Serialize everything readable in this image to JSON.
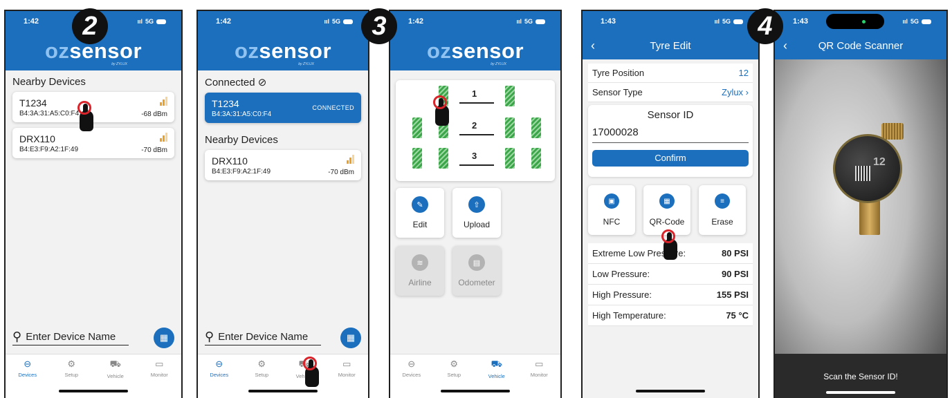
{
  "steps": [
    "2",
    "3",
    "4"
  ],
  "phone1": {
    "time": "1:42",
    "network": "5G",
    "logo": {
      "a": "oz",
      "b": "sensor",
      "by": "by ZYLUX"
    },
    "section": "Nearby Devices",
    "devices": [
      {
        "name": "T1234",
        "mac": "B4:3A:31:A5:C0:F4",
        "rssi": "-68 dBm"
      },
      {
        "name": "DRX110",
        "mac": "B4:E3:F9:A2:1F:49",
        "rssi": "-70 dBm"
      }
    ],
    "search_placeholder": "Enter Device Name"
  },
  "phone2": {
    "time": "1:42",
    "network": "5G",
    "connected_header": "Connected ⊘",
    "connected_device": {
      "name": "T1234",
      "mac": "B4:3A:31:A5:C0:F4",
      "status": "CONNECTED"
    },
    "section": "Nearby Devices",
    "devices": [
      {
        "name": "DRX110",
        "mac": "B4:E3:F9:A2:1F:49",
        "rssi": "-70 dBm"
      }
    ],
    "search_placeholder": "Enter Device Name"
  },
  "phone3": {
    "time": "1:42",
    "network": "5G",
    "axles": [
      "1",
      "2",
      "3"
    ],
    "actions": [
      {
        "label": "Edit",
        "icon": "pencil-icon",
        "enabled": true
      },
      {
        "label": "Upload",
        "icon": "upload-icon",
        "enabled": true
      },
      {
        "label": "Airline",
        "icon": "wind-icon",
        "enabled": false
      },
      {
        "label": "Odometer",
        "icon": "odometer-icon",
        "enabled": false
      }
    ]
  },
  "phone4": {
    "time": "1:43",
    "network": "5G",
    "title": "Tyre Edit",
    "tyre_position_label": "Tyre Position",
    "tyre_position": "12",
    "sensor_type_label": "Sensor Type",
    "sensor_type": "Zylux ›",
    "sensor_id_label": "Sensor ID",
    "sensor_id": "17000028",
    "confirm": "Confirm",
    "options": [
      {
        "label": "NFC",
        "icon": "nfc-icon"
      },
      {
        "label": "QR-Code",
        "icon": "qr-code-icon"
      },
      {
        "label": "Erase",
        "icon": "erase-icon"
      }
    ],
    "pressures": [
      {
        "label": "Extreme Low Pressure:",
        "value": "80 PSI"
      },
      {
        "label": "Low Pressure:",
        "value": "90 PSI"
      },
      {
        "label": "High Pressure:",
        "value": "155 PSI"
      },
      {
        "label": "High Temperature:",
        "value": "75 °C"
      }
    ]
  },
  "phone5": {
    "time": "1:43",
    "network": "5G",
    "title": "QR Code Scanner",
    "sensor_text": "12",
    "hint": "Scan the Sensor ID!"
  },
  "tabs": [
    {
      "label": "Devices",
      "icon": "link-icon"
    },
    {
      "label": "Setup",
      "icon": "gear-icon"
    },
    {
      "label": "Vehicle",
      "icon": "truck-icon"
    },
    {
      "label": "Monitor",
      "icon": "monitor-icon"
    }
  ],
  "colors": {
    "primary": "#1b6fbd",
    "tap_ring": "#d8242a",
    "signal": "#f0a020"
  }
}
